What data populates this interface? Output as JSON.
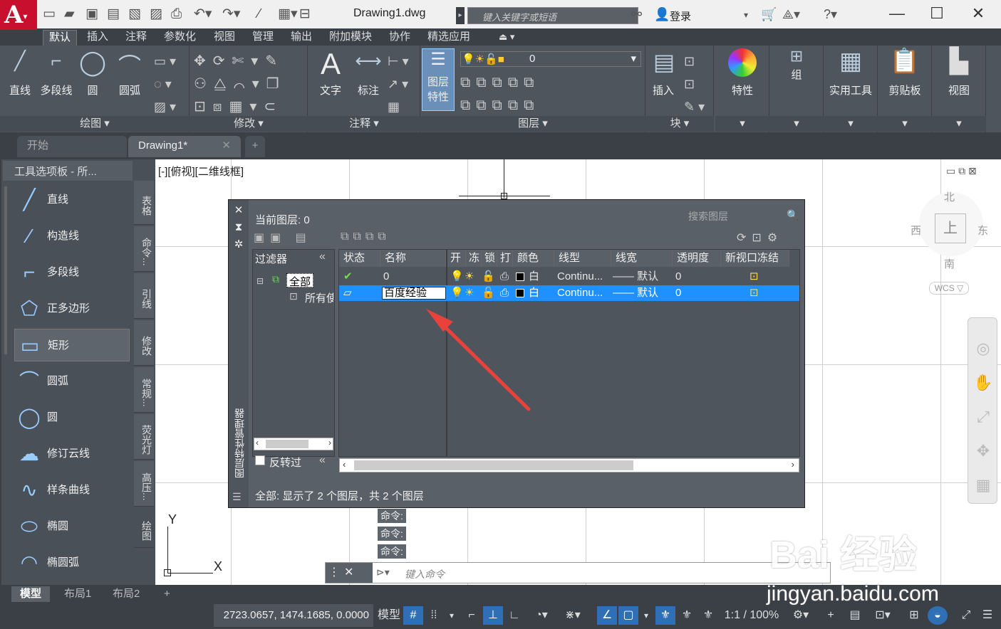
{
  "titlebar": {
    "logo": "A",
    "filename": "Drawing1.dwg",
    "search_placeholder": "键入关键字或短语",
    "login": "登录"
  },
  "menus": [
    "默认",
    "插入",
    "注释",
    "参数化",
    "视图",
    "管理",
    "输出",
    "附加模块",
    "协作",
    "精选应用"
  ],
  "ribbon": {
    "draw_tools": [
      "直线",
      "多段线",
      "圆",
      "圆弧"
    ],
    "panels": {
      "draw": "绘图 ▾",
      "modify": "修改 ▾",
      "annotate": "注释 ▾",
      "layer": "图层 ▾",
      "block": "块 ▾"
    },
    "text_tool": "文字",
    "dim_tool": "标注",
    "layer_props": "图层\n特性",
    "layer_current": "0",
    "insert": "插入",
    "properties": "特性",
    "group": "组",
    "utilities": "实用工具",
    "clipboard": "剪贴板",
    "view": "视图"
  },
  "doc_tabs": [
    "开始",
    "Drawing1*"
  ],
  "palette": {
    "title": "工具选项板 - 所...",
    "items": [
      "直线",
      "构造线",
      "多段线",
      "正多边形",
      "矩形",
      "圆弧",
      "圆",
      "修订云线",
      "样条曲线",
      "椭圆",
      "椭圆弧"
    ],
    "selected": "矩形",
    "vtabs": [
      "表格",
      "命令...",
      "引线",
      "修改",
      "常规...",
      "荧光灯",
      "高压...",
      "绘图"
    ]
  },
  "viewport_label": "[-][俯视][二维线框]",
  "layer_dialog": {
    "current": "当前图层: 0",
    "search_placeholder": "搜索图层",
    "filter_header": "过滤器",
    "filter_all": "全部",
    "filter_used": "所有使",
    "invert": "反转过",
    "side_title": "图层特性管理器",
    "columns": [
      "状态",
      "名称",
      "开",
      "冻",
      "锁",
      "打",
      "颜色",
      "线型",
      "线宽",
      "透明度",
      "新视口冻结"
    ],
    "rows": [
      {
        "name": "0",
        "color": "白",
        "linetype": "Continu...",
        "lineweight": "—— 默认",
        "transparency": "0"
      },
      {
        "name": "百度经验",
        "color": "白",
        "linetype": "Continu...",
        "lineweight": "—— 默认",
        "transparency": "0"
      }
    ],
    "status": "全部: 显示了 2 个图层，共 2 个图层"
  },
  "command_history": [
    "命令:",
    "命令:",
    "命令:"
  ],
  "command_placeholder": "键入命令",
  "viewcube": {
    "top": "上",
    "north": "北",
    "south": "南",
    "east": "东",
    "west": "西",
    "wcs": "WCS ▽"
  },
  "axes": {
    "y": "Y",
    "x": "X"
  },
  "layout_tabs": [
    "模型",
    "布局1",
    "布局2"
  ],
  "status": {
    "coords": "2723.0657, 1474.1685, 0.0000",
    "model": "模型",
    "scale": "1:1 / 100%"
  },
  "watermark": {
    "brand": "Bai 经验",
    "url": "jingyan.baidu.com"
  }
}
